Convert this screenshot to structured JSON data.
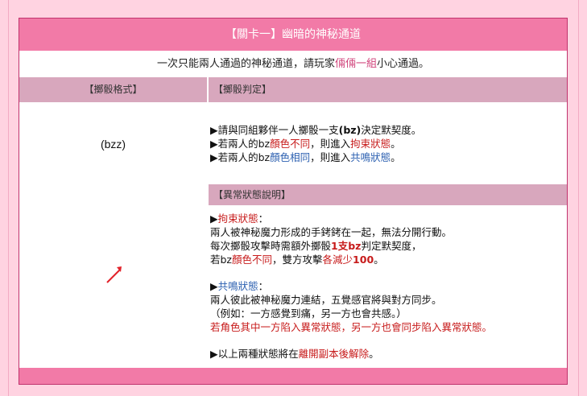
{
  "title": "【關卡一】幽暗的神秘通道",
  "intro": {
    "prefix": "一次只能兩人通過的神秘通道，請玩家",
    "highlight": "倆倆一組",
    "suffix": "小心通過。"
  },
  "headers": {
    "left": "【擲骰格式】",
    "right": "【擲骰判定】"
  },
  "dice_format": "(bzz)",
  "judgement": {
    "line1_a": "▶請與同組夥伴一人擲骰一支",
    "line1_b": "(bz)",
    "line1_c": "決定默契度。",
    "line2_a": "▶若兩人的bz",
    "line2_b": "顏色不同",
    "line2_c": "，則進入",
    "line2_d": "拘束狀態",
    "line2_e": "。",
    "line3_a": "▶若兩人的bz",
    "line3_b": "顏色相同",
    "line3_c": "，則進入",
    "line3_d": "共鳴狀態",
    "line3_e": "。"
  },
  "status_header": "【異常狀態說明】",
  "restraint": {
    "arrow": "▶",
    "name": "拘束狀態",
    "colon": "：",
    "desc1": "兩人被神秘魔力形成的手銬銬在一起，無法分開行動。",
    "desc2_a": "每次擲骰攻擊時需額外擲骰",
    "desc2_b": "1支bz",
    "desc2_c": "判定默契度，",
    "desc3_a": "若bz",
    "desc3_b": "顏色不同",
    "desc3_c": "，雙方攻擊",
    "desc3_d": "各減少",
    "desc3_e": "100",
    "desc3_f": "。"
  },
  "resonance": {
    "arrow": "▶",
    "name": "共鳴狀態",
    "colon": "：",
    "desc1": "兩人彼此被神秘魔力連結，五覺感官將與對方同步。",
    "desc2": "（例如：一方感覺到痛，另一方也會共感。）",
    "desc3": "若角色其中一方陷入異常狀態，另一方也會同步陷入異常狀態。"
  },
  "footer": {
    "a": "▶以上兩種狀態將在",
    "b": "離開副本後解除",
    "c": "。"
  },
  "colors": {
    "accent_pink": "#f27aa7",
    "header_mauve": "#d8a7bd",
    "background": "#ffd3e1",
    "red_text": "#c71b1b",
    "blue_text": "#2b5fb0"
  }
}
